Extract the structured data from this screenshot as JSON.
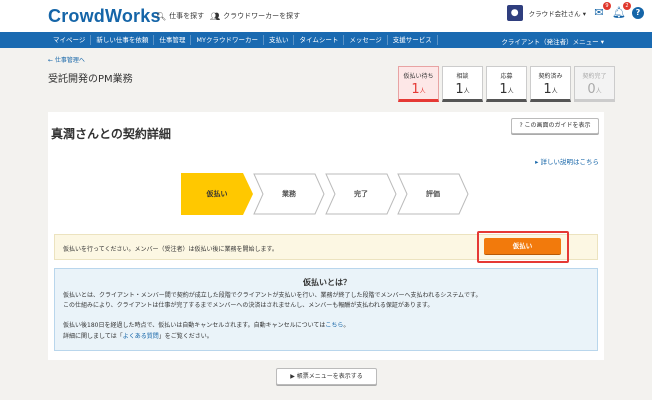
{
  "header": {
    "logo": "CrowdWorks",
    "nav_find_jobs": "仕事を探す",
    "nav_find_workers": "クラウドワーカーを探す",
    "client_name": "クラウド会社さん ▾",
    "messages_badge": "9",
    "notifications_badge": "2",
    "help": "?"
  },
  "navbar": {
    "items": [
      "マイページ",
      "新しい仕事を依頼",
      "仕事管理",
      "MYクラウドワーカー",
      "支払い",
      "タイムシート",
      "メッセージ",
      "支援サービス"
    ],
    "right_menu": "クライアント（発注者）メニュー ▾"
  },
  "breadcrumb": {
    "back": "← 仕事管理へ"
  },
  "project": {
    "title": "受託開発のPM業務"
  },
  "status_boxes": [
    {
      "label": "仮払い待ち",
      "count": "1",
      "unit": "人"
    },
    {
      "label": "相談",
      "count": "1",
      "unit": "人"
    },
    {
      "label": "応募",
      "count": "1",
      "unit": "人"
    },
    {
      "label": "契約済み",
      "count": "1",
      "unit": "人"
    },
    {
      "label": "契約完了",
      "count": "0",
      "unit": "人"
    }
  ],
  "contract": {
    "title": "真潤さんとの契約詳細",
    "guide_button": "? この画面のガイドを表示",
    "detail_link": "▸ 詳しい説明はこちら"
  },
  "steps": [
    "仮払い",
    "業務",
    "完了",
    "評価"
  ],
  "notice": {
    "text": "仮払いを行ってください。メンバー（受注者）は仮払い後に業務を開始します。",
    "pay_button": "仮払い"
  },
  "info": {
    "title": "仮払いとは？",
    "line1": "仮払いとは、クライアント・メンバー間で契約が成立した段階でクライアントが支払いを行い、業務が終了した段階でメンバーへ支払われるシステムです。",
    "line2": "この仕組みにより、クライアントは仕事が完了するまでメンバーへの決済はされませんし、メンバーも報酬が支払われる保証があります。",
    "line3_pre": "仮払い後180日を経過した時点で、仮払いは自動キャンセルされます。自動キャンセルについては",
    "line3_link": "こちら",
    "line3_post": "。",
    "line4_pre": "詳細に関しましては「",
    "line4_link": "よくある質問",
    "line4_post": "」をご覧ください。"
  },
  "footer": {
    "menu_button": "▶ 帳票メニューを表示する"
  },
  "colors": {
    "brand": "#1a6ab1",
    "step_active": "#ffc800",
    "pay_button": "#f27a0c",
    "highlight": "#e53935"
  }
}
